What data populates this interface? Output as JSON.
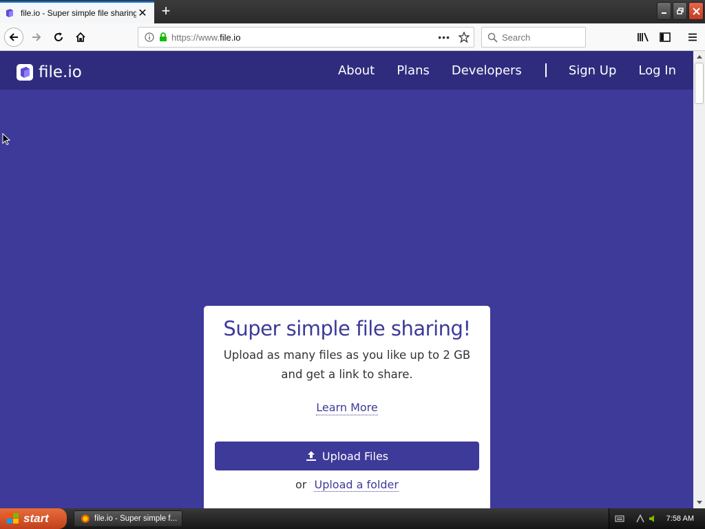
{
  "browser": {
    "tab_title": "file.io - Super simple file sharing",
    "url_host": "https://www.",
    "url_domain": "file.io",
    "search_placeholder": "Search"
  },
  "site": {
    "logo_text": "file.io",
    "nav": [
      "About",
      "Plans",
      "Developers",
      "Sign Up",
      "Log In"
    ]
  },
  "hero": {
    "title": "Super simple file sharing!",
    "subtitle": "Upload as many files as you like up to 2 GB and get a link to share.",
    "learn_more": "Learn More",
    "upload_button": "Upload Files",
    "or_text": "or",
    "upload_folder": "Upload a folder"
  },
  "taskbar": {
    "start_label": "start",
    "task_item": "file.io - Super simple f...",
    "clock": "7:58 AM"
  },
  "colors": {
    "brand": "#3d3a9a",
    "nav_bg": "#2f2c7e"
  }
}
